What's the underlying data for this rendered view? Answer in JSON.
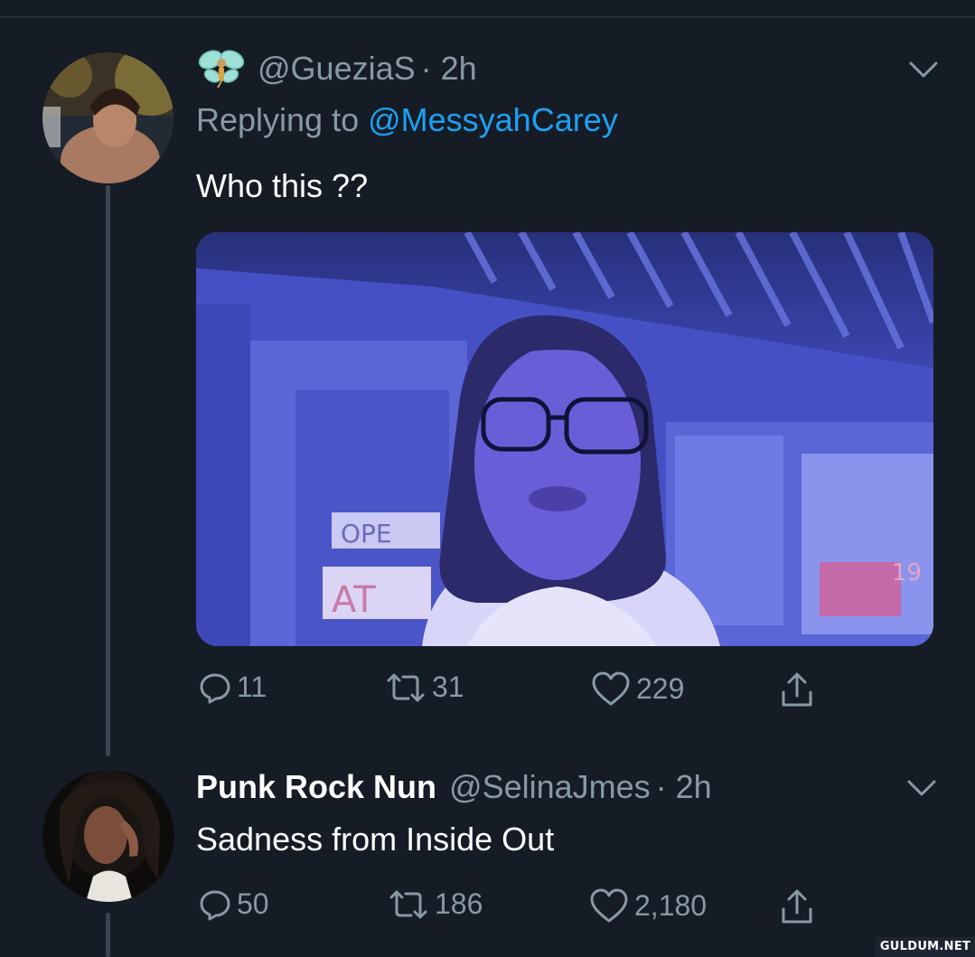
{
  "tweet1": {
    "handle": "@GueziaS",
    "time": "· 2h",
    "replying_prefix": "Replying to",
    "replying_to": "@MessyahCarey",
    "text": "Who this ??",
    "media_sign_text_1": "OPE",
    "media_sign_text_2": "AT",
    "media_sign_text_3": "19",
    "replies": "11",
    "retweets": "31",
    "likes": "229"
  },
  "tweet2": {
    "name": "Punk Rock Nun",
    "handle": "@SelinaJmes",
    "time": "· 2h",
    "text": "Sadness from Inside Out",
    "replies": "50",
    "retweets": "186",
    "likes": "2,180"
  },
  "watermark": "GULDUM.NET",
  "colors": {
    "background": "#161c26",
    "muted": "#8899a6",
    "link": "#1da1f2",
    "media_tint": "#4a55c8"
  },
  "icons": {
    "emoji": "fairy-emoji",
    "reply": "reply-icon",
    "retweet": "retweet-icon",
    "like": "heart-icon",
    "share": "share-icon",
    "menu": "chevron-down-icon"
  }
}
